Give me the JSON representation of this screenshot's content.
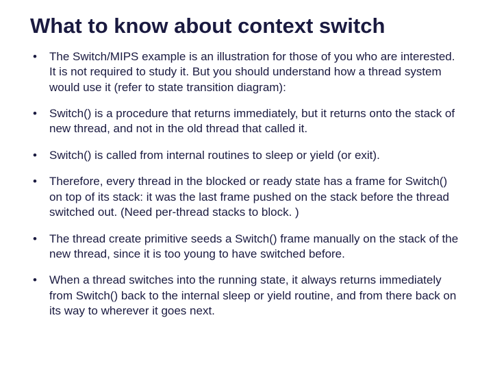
{
  "title": "What to know about context switch",
  "bullets": [
    "The Switch/MIPS example is an illustration for those of you who are interested.  It is not required to study it.  But you should understand how a thread system would use it (refer to state transition diagram):",
    "Switch() is a procedure that returns immediately, but it returns onto the stack of new thread, and not in the old thread that called it.",
    "Switch() is called from internal routines to sleep or yield (or exit).",
    "Therefore, every thread in the blocked or ready state has a frame for Switch() on top of its stack: it was the last frame pushed on the stack before the thread switched out.  (Need per-thread stacks to block. )",
    "The thread create primitive seeds a Switch() frame manually on the stack of the new thread, since it is too young to have switched before.",
    "When a thread switches into the running state, it always returns immediately from Switch() back to the internal sleep or yield routine, and from there back on its way to wherever it goes next."
  ]
}
